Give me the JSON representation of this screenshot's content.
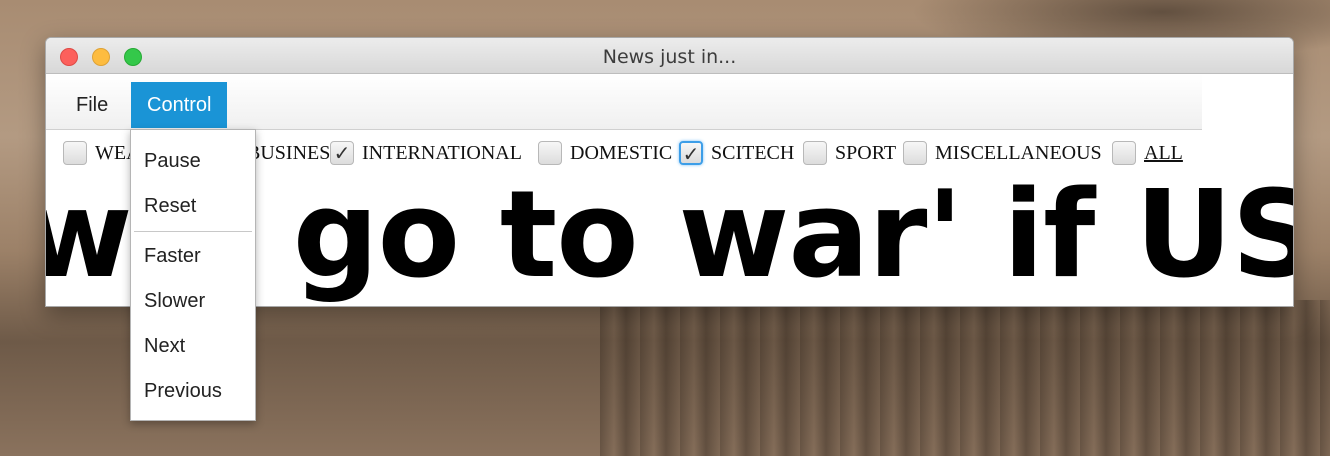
{
  "window": {
    "title": "News just in..."
  },
  "menubar": {
    "file_label": "File",
    "control_label": "Control"
  },
  "filters": [
    {
      "label": "WEATHER",
      "checked": false,
      "focused": false
    },
    {
      "label": "BUSINESS",
      "checked": true,
      "focused": false
    },
    {
      "label": "INTERNATIONAL",
      "checked": false,
      "focused": false
    },
    {
      "label": "DOMESTIC",
      "checked": true,
      "focused": true
    },
    {
      "label": "SCITECH",
      "checked": false,
      "focused": false
    },
    {
      "label": "SPORT",
      "checked": false,
      "focused": false
    },
    {
      "label": "MISCELLANEOUS",
      "checked": false,
      "focused": false
    },
    {
      "label": "ALL",
      "checked": false,
      "focused": false
    }
  ],
  "headline": {
    "text": "'will go to war' if US pr"
  },
  "control_menu": {
    "items": [
      "Pause",
      "Reset",
      "Faster",
      "Slower",
      "Next",
      "Previous"
    ]
  },
  "colors": {
    "menu_highlight": "#1a94d6",
    "focus_ring": "#3d9ee8"
  },
  "icons": {
    "checkmark": "check-icon"
  }
}
